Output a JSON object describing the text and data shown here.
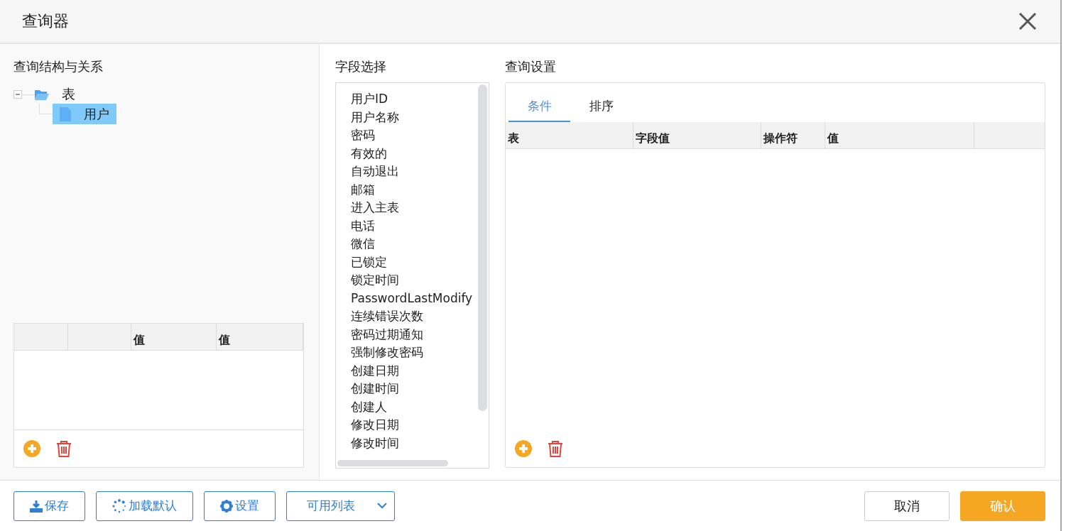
{
  "window": {
    "title": "查询器"
  },
  "structure": {
    "title": "查询结构与关系",
    "tree": [
      {
        "label": "表",
        "kind": "folder",
        "expanded": true,
        "selected": false,
        "children": [
          {
            "label": "用户",
            "kind": "file",
            "selected": true
          }
        ]
      }
    ],
    "table": {
      "columns": [
        {
          "kind": "blank"
        },
        {
          "kind": "blank"
        },
        {
          "kind": "text",
          "label": "值"
        },
        {
          "kind": "text",
          "label": "值"
        }
      ]
    }
  },
  "fields": {
    "title": "字段选择",
    "items": [
      "用户ID",
      "用户名称",
      "密码",
      "有效的",
      "自动退出",
      "邮箱",
      "进入主表",
      "电话",
      "微信",
      "已锁定",
      "锁定时间",
      "PasswordLastModify",
      "连续错误次数",
      "密码过期通知",
      "强制修改密码",
      "创建日期",
      "创建时间",
      "创建人",
      "修改日期",
      "修改时间"
    ]
  },
  "settings": {
    "title": "查询设置",
    "tabs": [
      {
        "label": "条件",
        "selected": true
      },
      {
        "label": "排序",
        "selected": false
      }
    ],
    "columns": [
      "表",
      "字段值",
      "操作符",
      "值"
    ]
  },
  "footer": {
    "left_buttons": [
      {
        "label": "保存",
        "kind": "download"
      },
      {
        "label": "加载默认",
        "kind": "spinner"
      },
      {
        "label": "设置",
        "kind": "gear"
      },
      {
        "label": "可用列表",
        "kind": "dropdown"
      }
    ],
    "right_buttons": [
      {
        "label": "取消",
        "kind": "secondary"
      },
      {
        "label": "确认",
        "kind": "primary"
      }
    ]
  }
}
